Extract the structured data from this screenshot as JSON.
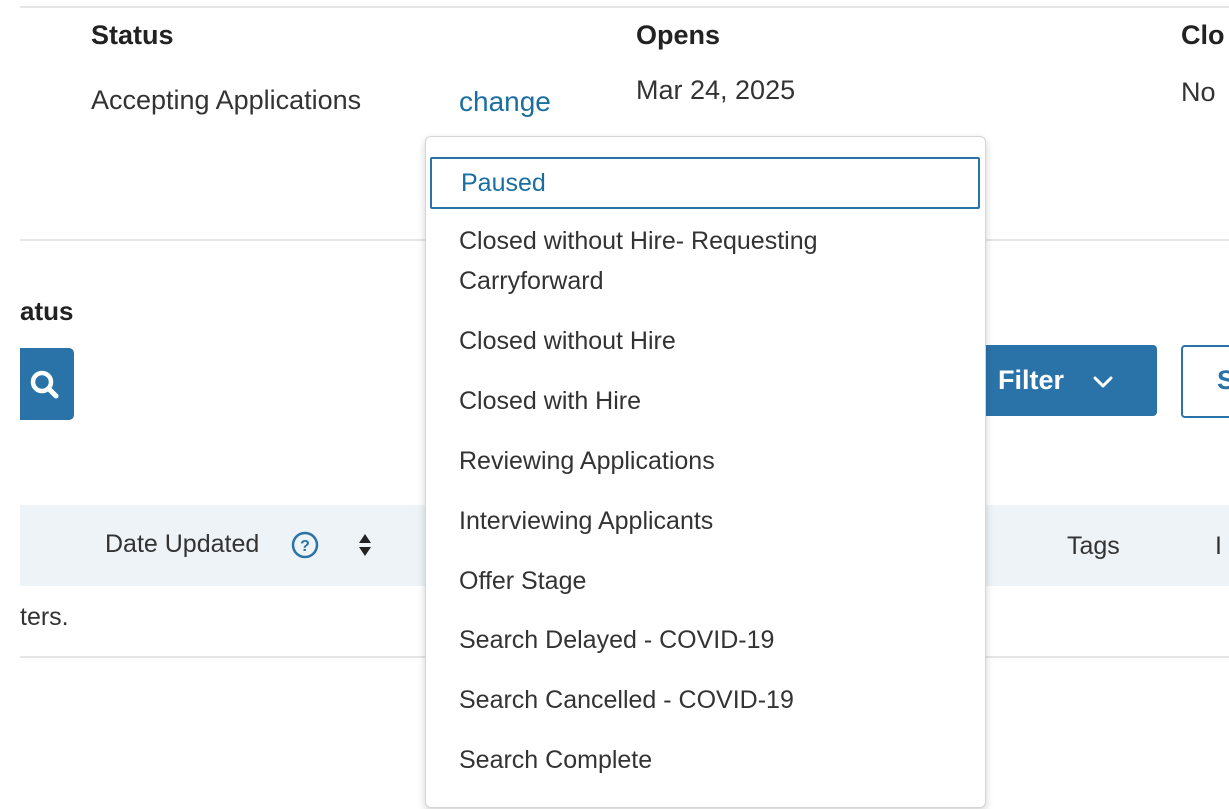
{
  "header": {
    "status_label": "Status",
    "status_value": "Accepting Applications",
    "change_link": "change",
    "opens_label": "Opens",
    "opens_value": "Mar 24, 2025",
    "closes_label_partial": "Clo",
    "closes_value_partial": "No"
  },
  "section": {
    "title_partial": "atus"
  },
  "toolbar": {
    "search_icon": "search-icon",
    "filter_label": "Filter",
    "filter_icon": "chevron-down-icon",
    "second_button_partial": "S"
  },
  "table": {
    "columns": {
      "date_updated": "Date Updated",
      "tags": "Tags",
      "edge_partial": "I"
    },
    "empty_message_partial": "ters."
  },
  "dropdown": {
    "options": [
      {
        "label": "Paused",
        "selected": true
      },
      {
        "label": "Closed without Hire- Requesting",
        "label_line2": "Carryforward"
      },
      {
        "label": "Closed without Hire"
      },
      {
        "label": "Closed with Hire"
      },
      {
        "label": "Reviewing Applications"
      },
      {
        "label": "Interviewing Applicants"
      },
      {
        "label": "Offer Stage"
      },
      {
        "label": "Search Delayed - COVID-19"
      },
      {
        "label": "Search Cancelled - COVID-19"
      },
      {
        "label": "Search Complete"
      }
    ]
  },
  "colors": {
    "accent": "#2a73a8",
    "link": "#1a6ea0",
    "table_header_bg": "#eef3f7"
  }
}
